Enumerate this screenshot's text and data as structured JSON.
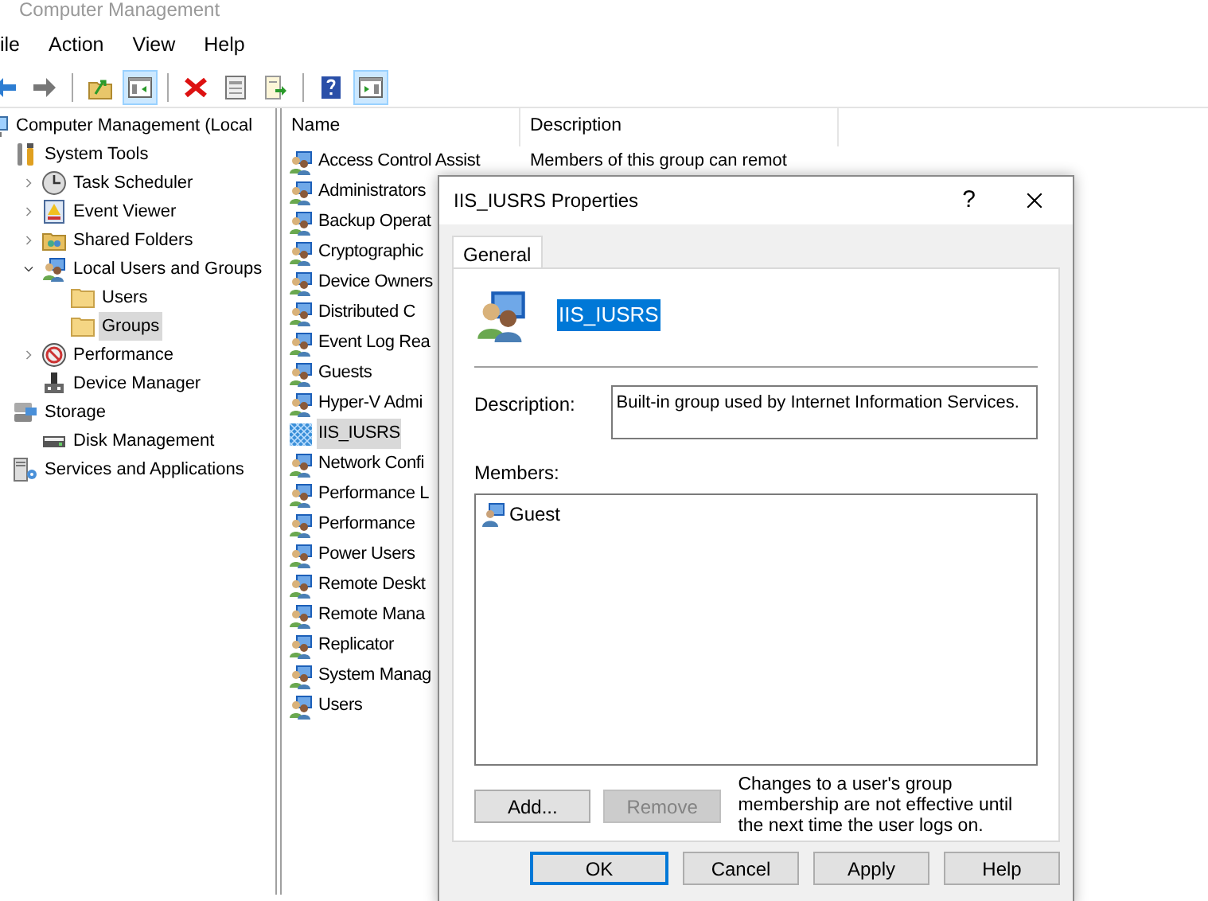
{
  "window": {
    "title": "Computer Management"
  },
  "menu": [
    "ile",
    "Action",
    "View",
    "Help"
  ],
  "toolbar": [
    {
      "kind": "back",
      "selected": false
    },
    {
      "kind": "forward",
      "selected": false
    },
    {
      "kind": "sep"
    },
    {
      "kind": "up",
      "selected": false
    },
    {
      "kind": "tree",
      "selected": true
    },
    {
      "kind": "sep"
    },
    {
      "kind": "delete",
      "selected": false
    },
    {
      "kind": "properties",
      "selected": false
    },
    {
      "kind": "export",
      "selected": false
    },
    {
      "kind": "sep"
    },
    {
      "kind": "help",
      "selected": false
    },
    {
      "kind": "pane",
      "selected": true
    }
  ],
  "tree": [
    {
      "label": "Computer Management (Local",
      "kind": "computer",
      "selected": false,
      "children": [
        {
          "label": "System Tools",
          "kind": "tools",
          "selected": false,
          "children": [
            {
              "label": "Task Scheduler",
              "kind": "clock",
              "expanded": false,
              "selected": false
            },
            {
              "label": "Event Viewer",
              "kind": "log",
              "expanded": false,
              "selected": false
            },
            {
              "label": "Shared Folders",
              "kind": "share",
              "expanded": false,
              "selected": false
            },
            {
              "label": "Local Users and Groups",
              "kind": "group",
              "expanded": true,
              "selected": false,
              "children": [
                {
                  "label": "Users",
                  "kind": "folder",
                  "selected": false
                },
                {
                  "label": "Groups",
                  "kind": "folder",
                  "selected": true
                }
              ]
            },
            {
              "label": "Performance",
              "kind": "gauge",
              "expanded": false,
              "selected": false
            },
            {
              "label": "Device Manager",
              "kind": "device",
              "selected": false
            }
          ]
        },
        {
          "label": "Storage",
          "kind": "storage",
          "selected": false,
          "children": [
            {
              "label": "Disk Management",
              "kind": "disk",
              "selected": false
            }
          ]
        },
        {
          "label": "Services and Applications",
          "kind": "services",
          "selected": false
        }
      ]
    }
  ],
  "list": {
    "columns": [
      "Name",
      "Description"
    ],
    "rows": [
      {
        "name": "Access Control Assist",
        "description": "Members of this group can remot",
        "selected": false
      },
      {
        "name": "Administrators",
        "selected": false
      },
      {
        "name": "Backup Operat",
        "selected": false
      },
      {
        "name": "Cryptographic",
        "selected": false
      },
      {
        "name": "Device Owners",
        "selected": false
      },
      {
        "name": "Distributed C",
        "selected": false
      },
      {
        "name": "Event Log Rea",
        "selected": false
      },
      {
        "name": "Guests",
        "selected": false
      },
      {
        "name": "Hyper-V Admi",
        "selected": false
      },
      {
        "name": "IIS_IUSRS",
        "selected": true
      },
      {
        "name": "Network Confi",
        "selected": false
      },
      {
        "name": "Performance L",
        "selected": false
      },
      {
        "name": "Performance",
        "selected": false
      },
      {
        "name": "Power Users",
        "selected": false
      },
      {
        "name": "Remote Deskt",
        "selected": false
      },
      {
        "name": "Remote Mana",
        "selected": false
      },
      {
        "name": "Replicator",
        "selected": false
      },
      {
        "name": "System Manag",
        "selected": false
      },
      {
        "name": "Users",
        "selected": false
      }
    ]
  },
  "dialog": {
    "title": "IIS_IUSRS Properties",
    "help": "?",
    "tabs": [
      {
        "label": "General",
        "selected": true
      }
    ],
    "group_name": "IIS_IUSRS",
    "description_label": "Description:",
    "description": "Built-in group used by Internet Information Services.",
    "members_label": "Members:",
    "members": [
      {
        "name": "Guest"
      }
    ],
    "member_buttons": [
      {
        "label": "Add...",
        "disabled": false
      },
      {
        "label": "Remove",
        "disabled": true
      }
    ],
    "note": "Changes to a user's group membership are not effective until the next time the user logs on.",
    "buttons": [
      {
        "label": "OK",
        "default": true
      },
      {
        "label": "Cancel",
        "default": false
      },
      {
        "label": "Apply",
        "default": false
      },
      {
        "label": "Help",
        "default": false
      }
    ]
  }
}
